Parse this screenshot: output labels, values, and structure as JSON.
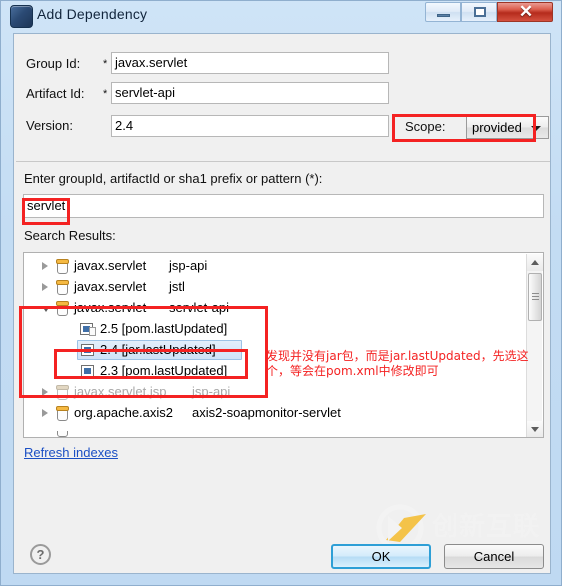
{
  "window": {
    "title": "Add Dependency",
    "icon": "maven-dependency-icon",
    "controls": {
      "minimize": "minimize-icon",
      "maximize": "maximize-icon",
      "close": "✕"
    }
  },
  "form": {
    "group_id": {
      "label": "Group Id:",
      "required_mark": "*",
      "value": "javax.servlet"
    },
    "artifact_id": {
      "label": "Artifact Id:",
      "required_mark": "*",
      "value": "servlet-api"
    },
    "version": {
      "label": "Version:",
      "value": "2.4"
    },
    "scope": {
      "label": "Scope:",
      "value": "provided",
      "arrow": "chevron-down-icon"
    }
  },
  "search": {
    "prompt": "Enter groupId, artifactId or sha1 prefix or pattern (*):",
    "value": "servlet",
    "placeholder": ""
  },
  "results": {
    "label": "Search Results:",
    "rows": [
      {
        "twisty": "collapsed",
        "icon": "jar-icon",
        "group": "javax.servlet",
        "artifact": "jsp-api",
        "dim": false,
        "indent": 0
      },
      {
        "twisty": "collapsed",
        "icon": "jar-icon",
        "group": "javax.servlet",
        "artifact": "jstl",
        "dim": false,
        "indent": 0
      },
      {
        "twisty": "expanded",
        "icon": "jar-icon",
        "group": "javax.servlet",
        "artifact": "servlet-api",
        "dim": false,
        "indent": 0
      },
      {
        "twisty": "none",
        "icon": "version-pom-icon",
        "group": "2.5 [pom.lastUpdated]",
        "artifact": "",
        "dim": false,
        "indent": 1
      },
      {
        "twisty": "none",
        "icon": "version-icon",
        "group": "2.4 [jar.lastUpdated]",
        "artifact": "",
        "dim": false,
        "indent": 1,
        "selected": true
      },
      {
        "twisty": "none",
        "icon": "version-icon",
        "group": "2.3 [pom.lastUpdated]",
        "artifact": "",
        "dim": false,
        "indent": 1
      },
      {
        "twisty": "collapsed",
        "icon": "jar-icon",
        "group": "javax.servlet.jsp",
        "artifact": "jsp-api",
        "dim": true,
        "indent": 0
      },
      {
        "twisty": "collapsed",
        "icon": "jar-icon",
        "group": "org.apache.axis2",
        "artifact": "axis2-soapmonitor-servlet",
        "dim": false,
        "indent": 0
      }
    ],
    "scrollbar": {
      "up": "scroll-up-icon",
      "down": "scroll-down-icon"
    }
  },
  "refresh_link": "Refresh indexes",
  "annotation": {
    "line1": "发现并没有jar包，而是jar.lastUpdated，先选这",
    "line2": "个，等会在pom.xml中修改即可",
    "color": "#f42222"
  },
  "watermark": {
    "title": "创新互联",
    "subtitle": "CHUANG XIN HU LIAN",
    "logo": "cx-logo-icon"
  },
  "footer": {
    "help": "?",
    "ok": "OK",
    "cancel": "Cancel"
  },
  "colors": {
    "accent": "#2e9fd6",
    "annotation_red": "#f42222",
    "link_blue": "#1b4fc4",
    "titlebar": "#c3dcf3"
  }
}
